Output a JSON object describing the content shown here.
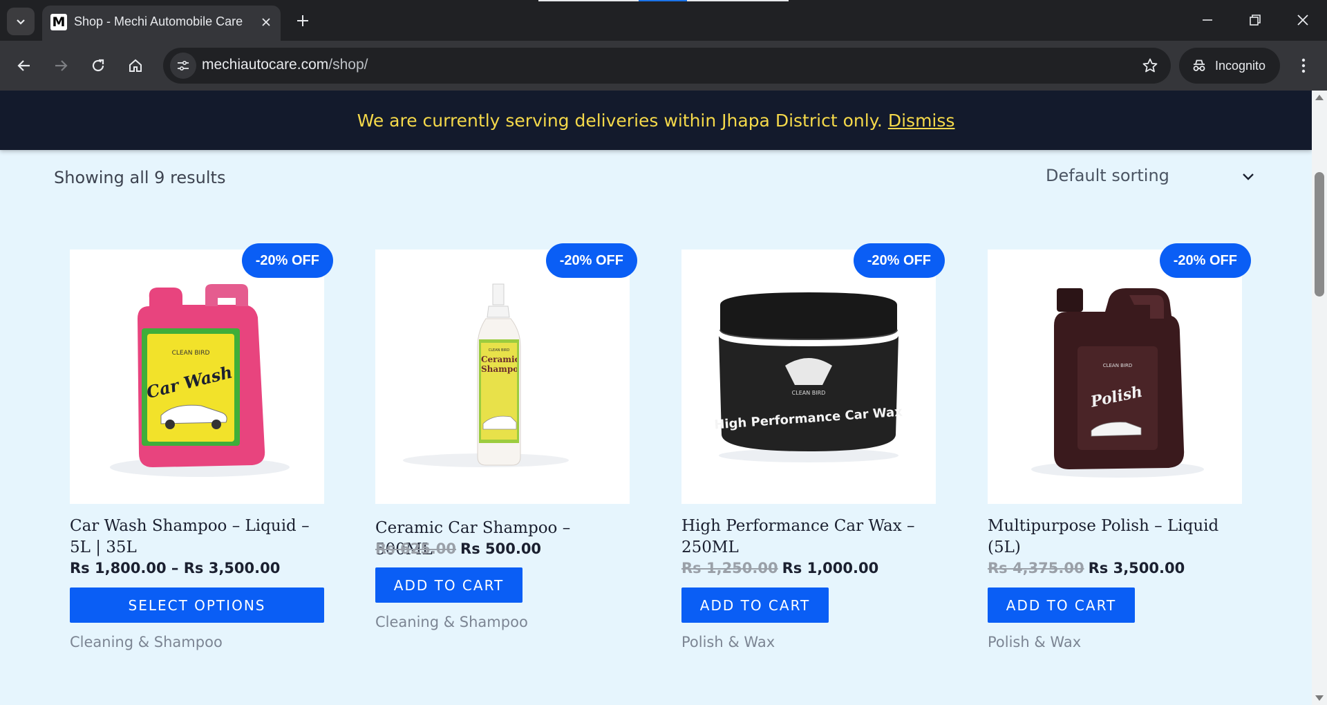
{
  "browser": {
    "tab_title": "Shop - Mechi Automobile Care",
    "favicon_letter": "M",
    "url_domain": "mechiautocare.com",
    "url_path": "/shop/",
    "incognito_label": "Incognito"
  },
  "notice": {
    "text": "We are currently serving deliveries within Jhapa District only.",
    "dismiss_label": "Dismiss"
  },
  "shop": {
    "result_count": "Showing all 9 results",
    "sorting_selected": "Default sorting"
  },
  "products": [
    {
      "badge": "-20% OFF",
      "title": "Car Wash Shampoo – Liquid – 5L | 35L",
      "price_old": "",
      "price": "Rs 1,800.00 – Rs 3,500.00",
      "button": "SELECT OPTIONS",
      "category": "Cleaning & Shampoo",
      "image_label": "Car Wash",
      "image_brand": "CLEAN BIRD"
    },
    {
      "badge": "-20% OFF",
      "title": "Ceramic Car Shampoo – 500ML",
      "price_old": "Rs 625.00",
      "price": "Rs 500.00",
      "button": "ADD TO CART",
      "category": "Cleaning & Shampoo",
      "image_label": "Ceramic Shampoo",
      "image_brand": "CLEAN BIRD"
    },
    {
      "badge": "-20% OFF",
      "title": "High Performance Car Wax – 250ML",
      "price_old": "Rs 1,250.00",
      "price": "Rs 1,000.00",
      "button": "ADD TO CART",
      "category": "Polish & Wax",
      "image_label": "High Performance Car Wax",
      "image_brand": "CLEAN BIRD"
    },
    {
      "badge": "-20% OFF",
      "title": "Multipurpose Polish – Liquid (5L)",
      "price_old": "Rs 4,375.00",
      "price": "Rs 3,500.00",
      "button": "ADD TO CART",
      "category": "Polish & Wax",
      "image_label": "Polish",
      "image_brand": "CLEAN BIRD"
    }
  ],
  "colors": {
    "accent": "#0a5ef5",
    "notice_bg": "#131a2c",
    "notice_text": "#f5d94a",
    "page_bg": "#e6f5fd"
  }
}
